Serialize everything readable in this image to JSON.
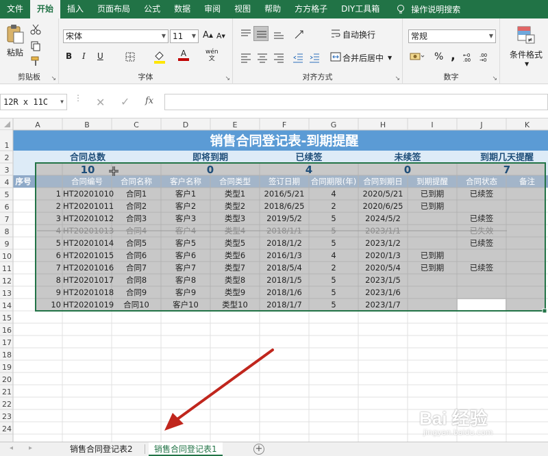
{
  "menu": {
    "tabs": [
      {
        "label": "文件"
      },
      {
        "label": "开始"
      },
      {
        "label": "插入"
      },
      {
        "label": "页面布局"
      },
      {
        "label": "公式"
      },
      {
        "label": "数据"
      },
      {
        "label": "审阅"
      },
      {
        "label": "视图"
      },
      {
        "label": "帮助"
      },
      {
        "label": "方方格子"
      },
      {
        "label": "DIY工具箱"
      }
    ],
    "search_label": "操作说明搜索"
  },
  "ribbon": {
    "clipboard": {
      "label": "剪贴板",
      "paste": "粘贴"
    },
    "font": {
      "label": "字体",
      "name": "宋体",
      "size": "11",
      "bold": "B",
      "italic": "I",
      "underline": "U",
      "grow": "A",
      "shrink": "A",
      "font_color": "A",
      "phonetic": "wén"
    },
    "alignment": {
      "label": "对齐方式",
      "wrap": "自动换行",
      "merge": "合并后居中"
    },
    "number": {
      "label": "数字",
      "format": "常规",
      "percent": "%",
      "comma": ","
    },
    "styles": {
      "conditional": "条件格式"
    }
  },
  "formula_bar": {
    "name_box": "12R x 11C",
    "fx": "fx"
  },
  "sheet": {
    "title": "销售合同登记表-到期提醒",
    "summary_labels": [
      "合同总数",
      "即将到期",
      "已续签",
      "未续签",
      "到期几天提醒"
    ],
    "summary_values": [
      "10",
      "0",
      "4",
      "0",
      "7"
    ],
    "headers": [
      "序号",
      "合同编号",
      "合同名称",
      "客户名称",
      "合同类型",
      "签订日期",
      "合同期限(年)",
      "合同到期日",
      "到期提醒",
      "合同状态",
      "备注"
    ],
    "rows": [
      [
        "1",
        "HT20201010",
        "合同1",
        "客户1",
        "类型1",
        "2016/5/21",
        "4",
        "2020/5/21",
        "已到期",
        "已续签",
        ""
      ],
      [
        "2",
        "HT20201011",
        "合同2",
        "客户2",
        "类型2",
        "2018/6/25",
        "2",
        "2020/6/25",
        "已到期",
        "",
        ""
      ],
      [
        "3",
        "HT20201012",
        "合同3",
        "客户3",
        "类型3",
        "2019/5/2",
        "5",
        "2024/5/2",
        "",
        "已续签",
        ""
      ],
      [
        "4",
        "HT20201013",
        "合同4",
        "客户4",
        "类型4",
        "2018/1/1",
        "5",
        "2023/1/1",
        "",
        "已失效",
        ""
      ],
      [
        "5",
        "HT20201014",
        "合同5",
        "客户5",
        "类型5",
        "2018/1/2",
        "5",
        "2023/1/2",
        "",
        "已续签",
        ""
      ],
      [
        "6",
        "HT20201015",
        "合同6",
        "客户6",
        "类型6",
        "2016/1/3",
        "4",
        "2020/1/3",
        "已到期",
        "",
        ""
      ],
      [
        "7",
        "HT20201016",
        "合同7",
        "客户7",
        "类型7",
        "2018/5/4",
        "2",
        "2020/5/4",
        "已到期",
        "已续签",
        ""
      ],
      [
        "8",
        "HT20201017",
        "合同8",
        "客户8",
        "类型8",
        "2018/1/5",
        "5",
        "2023/1/5",
        "",
        "",
        ""
      ],
      [
        "9",
        "HT20201018",
        "合同9",
        "客户9",
        "类型9",
        "2018/1/6",
        "5",
        "2023/1/6",
        "",
        "",
        ""
      ],
      [
        "10",
        "HT20201019",
        "合同10",
        "客户10",
        "类型10",
        "2018/1/7",
        "5",
        "2023/1/7",
        "",
        "",
        ""
      ]
    ],
    "struck_row": 3,
    "cols": [
      "A",
      "B",
      "C",
      "D",
      "E",
      "F",
      "G",
      "H",
      "I",
      "J",
      "K"
    ],
    "row_numbers": [
      "1",
      "2",
      "3",
      "4",
      "5",
      "6",
      "7",
      "8",
      "9",
      "10",
      "11",
      "12",
      "13",
      "14",
      "15",
      "16",
      "17",
      "18",
      "19",
      "20",
      "21",
      "22",
      "23",
      "24"
    ]
  },
  "tabs": [
    {
      "label": "销售合同登记表2"
    },
    {
      "label": "销售合同登记表1"
    }
  ],
  "watermark": {
    "logo": "Bai 经验",
    "url": "jingyan.baidu.com"
  },
  "colors": {
    "brand": "#217346",
    "title_bg": "#5b9bd5",
    "summary_bg": "#ddebf7",
    "summary_text": "#1f4e79",
    "header_bg": "#8ea9c8",
    "selection": "#c8c8c8",
    "arrow": "#c0261d"
  }
}
